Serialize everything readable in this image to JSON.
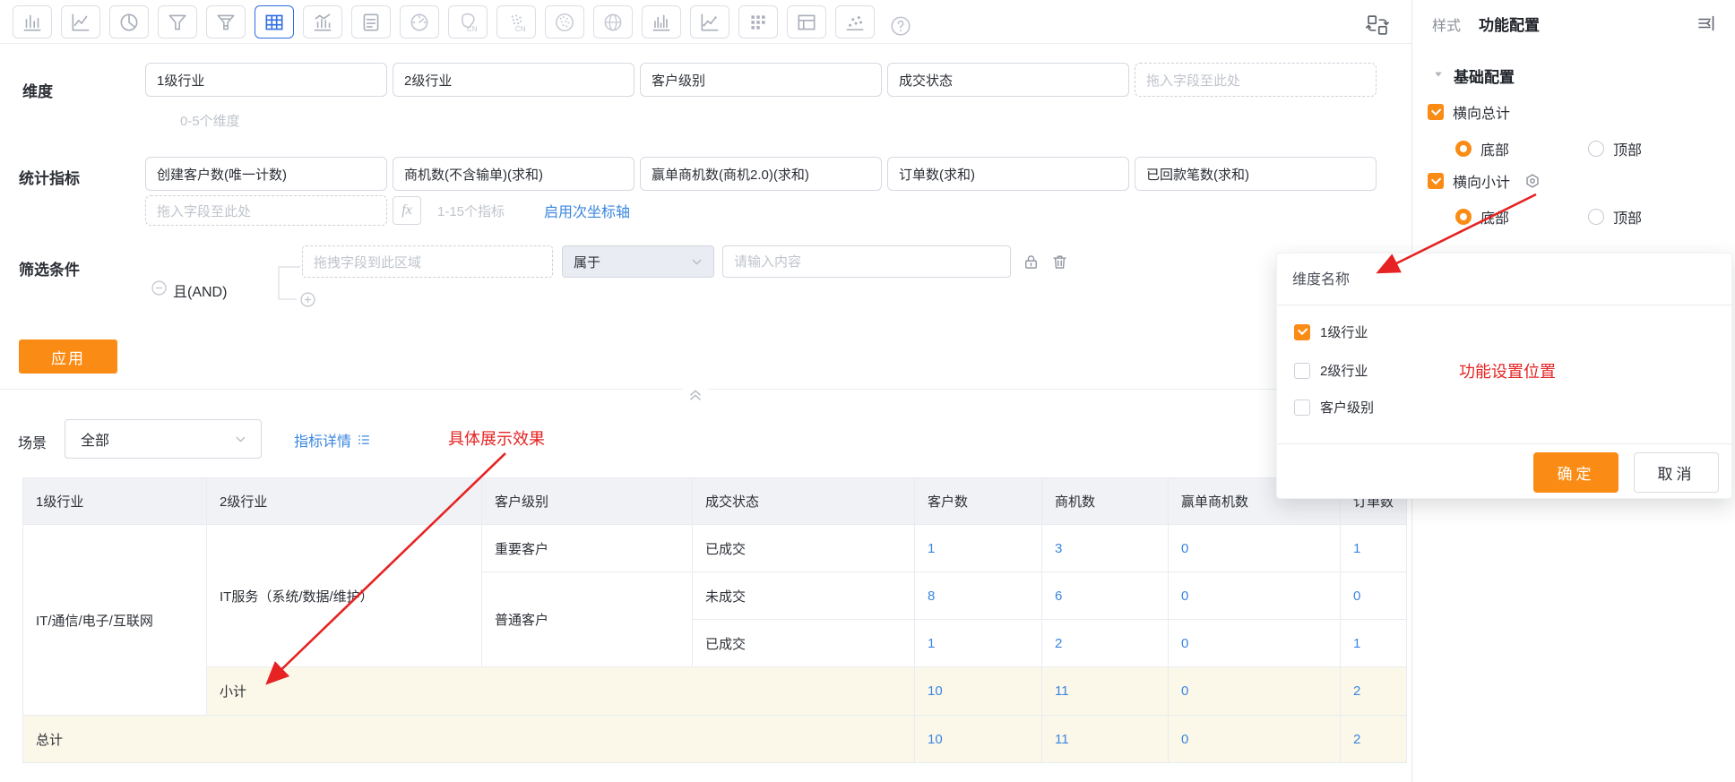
{
  "toolbar": {
    "chart_types": [
      {
        "name": "bar-chart",
        "selected": false
      },
      {
        "name": "line-chart",
        "selected": false
      },
      {
        "name": "pie-chart",
        "selected": false
      },
      {
        "name": "funnel-chart",
        "selected": false
      },
      {
        "name": "funnel-striped-chart",
        "selected": false
      },
      {
        "name": "crosstab-table",
        "selected": true
      },
      {
        "name": "combo-chart",
        "selected": false
      },
      {
        "name": "report-doc",
        "selected": false
      },
      {
        "name": "gauge-chart",
        "selected": false
      },
      {
        "name": "china-map",
        "selected": false
      },
      {
        "name": "china-map-dots",
        "selected": false
      },
      {
        "name": "world-map-dots",
        "selected": false
      },
      {
        "name": "globe-chart",
        "selected": false
      },
      {
        "name": "histogram-chart",
        "selected": false
      },
      {
        "name": "area-line-chart",
        "selected": false
      },
      {
        "name": "matrix-chart",
        "selected": false
      },
      {
        "name": "layout-table",
        "selected": false
      },
      {
        "name": "scatter-chart",
        "selected": false
      }
    ]
  },
  "dimensions": {
    "label": "维度",
    "fields": [
      "1级行业",
      "2级行业",
      "客户级别",
      "成交状态"
    ],
    "placeholder": "拖入字段至此处",
    "hint": "0-5个维度"
  },
  "metrics": {
    "label": "统计指标",
    "fields": [
      "创建客户数(唯一计数)",
      "商机数(不含输单)(求和)",
      "赢单商机数(商机2.0)(求和)",
      "订单数(求和)",
      "已回款笔数(求和)"
    ],
    "placeholder": "拖入字段至此处",
    "fx": "fx",
    "hint": "1-15个指标",
    "secondary_axis_link": "启用次坐标轴"
  },
  "filters": {
    "label": "筛选条件",
    "and": "且(AND)",
    "drop_placeholder": "拖拽字段到此区域",
    "operator": "属于",
    "value_placeholder": "请输入内容"
  },
  "apply_button": "应用",
  "scene": {
    "label": "场景",
    "value": "全部",
    "detail_link": "指标详情"
  },
  "annotations": {
    "table_note": "具体展示效果",
    "popup_note": "功能设置位置"
  },
  "table": {
    "headers": [
      "1级行业",
      "2级行业",
      "客户级别",
      "成交状态",
      "客户数",
      "商机数",
      "赢单商机数",
      "订单数"
    ],
    "industry_l1": "IT/通信/电子/互联网",
    "industry_l2": "IT服务（系统/数据/维护）",
    "rows": [
      {
        "customer_level": "重要客户",
        "deal_status": "已成交",
        "values": [
          "1",
          "3",
          "0",
          "1"
        ]
      },
      {
        "customer_level": "普通客户",
        "deal_status": "未成交",
        "values": [
          "8",
          "6",
          "0",
          "0"
        ]
      },
      {
        "deal_status": "已成交",
        "values": [
          "1",
          "2",
          "0",
          "1"
        ]
      }
    ],
    "subtotal": {
      "label": "小计",
      "values": [
        "10",
        "11",
        "0",
        "2"
      ]
    },
    "total": {
      "label": "总计",
      "values": [
        "10",
        "11",
        "0",
        "2"
      ]
    }
  },
  "panel": {
    "tab_style": "样式",
    "tab_function": "功能配置",
    "section": "基础配置",
    "row_total": {
      "label": "横向总计",
      "checked": true,
      "options": [
        "底部",
        "顶部"
      ],
      "selected": "底部"
    },
    "row_subtotal": {
      "label": "横向小计",
      "checked": true,
      "options": [
        "底部",
        "顶部"
      ],
      "selected": "底部"
    }
  },
  "popup": {
    "title": "维度名称",
    "options": [
      {
        "label": "1级行业",
        "checked": true
      },
      {
        "label": "2级行业",
        "checked": false
      },
      {
        "label": "客户级别",
        "checked": false
      }
    ],
    "confirm": "确定",
    "cancel": "取消"
  },
  "colors": {
    "accent_orange": "#fa8c16",
    "link_blue": "#3a86e0",
    "annotation_red": "#e62222",
    "selected_tool_blue": "#2f6ee3",
    "subtotal_row_bg": "#fcf8e9",
    "table_header_bg": "#f1f2f6"
  }
}
